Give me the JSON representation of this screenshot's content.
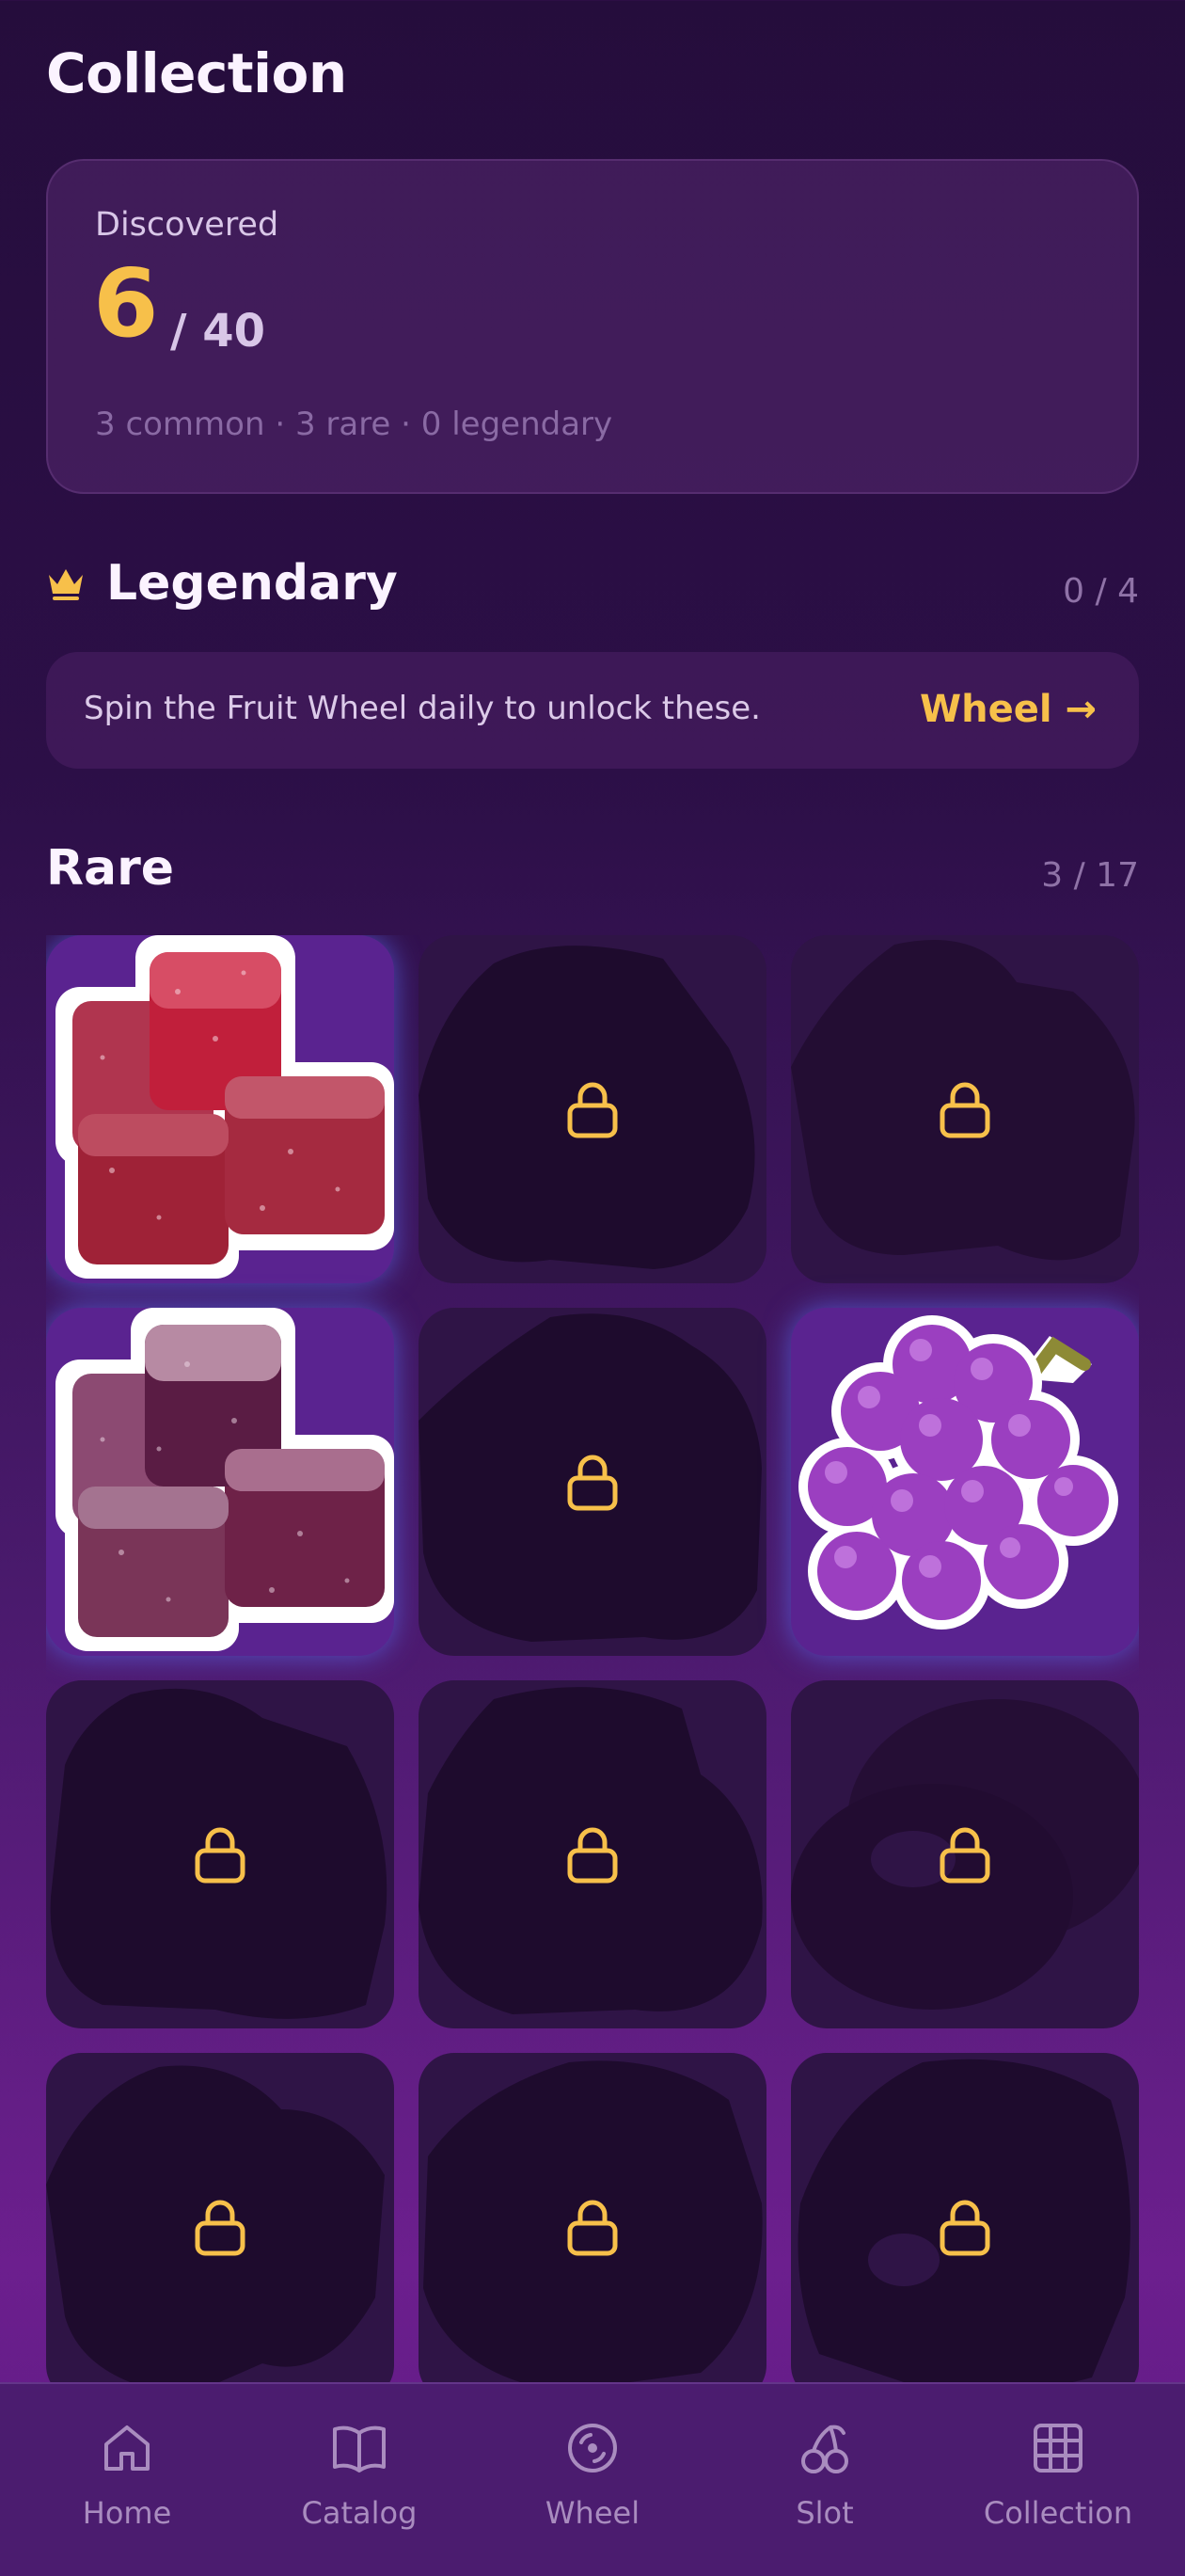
{
  "header": {
    "title": "Collection"
  },
  "discovered": {
    "label": "Discovered",
    "count": "6",
    "total": "/ 40",
    "breakdown": "3 common · 3 rare · 0 legendary"
  },
  "legendary": {
    "title": "Legendary",
    "count": "0 / 4",
    "info": "Spin the Fruit Wheel daily to unlock these.",
    "link_label": "Wheel →"
  },
  "rare": {
    "title": "Rare",
    "count": "3 / 17",
    "tiles": [
      {
        "item": "red gummy cubes",
        "unlocked": true
      },
      {
        "item": "locked",
        "unlocked": false
      },
      {
        "item": "locked",
        "unlocked": false
      },
      {
        "item": "purple gummy cubes",
        "unlocked": true
      },
      {
        "item": "locked",
        "unlocked": false
      },
      {
        "item": "grape gummies",
        "unlocked": true
      },
      {
        "item": "locked",
        "unlocked": false
      },
      {
        "item": "locked",
        "unlocked": false
      },
      {
        "item": "locked",
        "unlocked": false
      },
      {
        "item": "locked",
        "unlocked": false
      },
      {
        "item": "locked",
        "unlocked": false
      },
      {
        "item": "locked",
        "unlocked": false
      }
    ]
  },
  "tabbar": {
    "items": [
      {
        "label": "Home",
        "icon": "home-icon"
      },
      {
        "label": "Catalog",
        "icon": "book-icon"
      },
      {
        "label": "Wheel",
        "icon": "wheel-icon"
      },
      {
        "label": "Slot",
        "icon": "cherry-icon"
      },
      {
        "label": "Collection",
        "icon": "grid-icon"
      }
    ],
    "active": "Collection"
  },
  "colors": {
    "accent": "#f7c04a",
    "background": "#2c0f47",
    "tab_bar": "#4b1c6f",
    "locked_tile": "#2f1446"
  }
}
